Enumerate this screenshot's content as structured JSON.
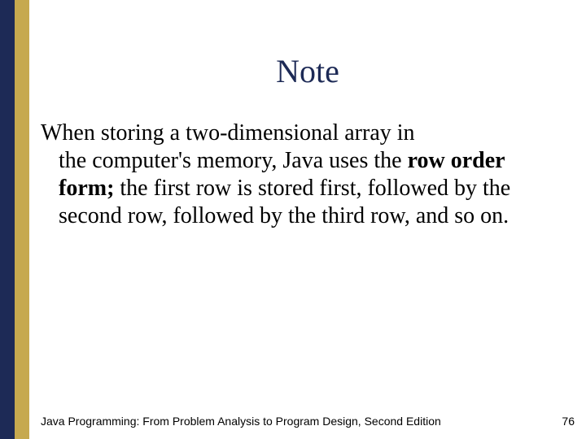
{
  "slide": {
    "title": "Note",
    "body_line1": "When storing a two-dimensional array in",
    "body_rest_pre_bold": "the computer's memory, Java uses the ",
    "body_bold": "row order form;",
    "body_rest_post_bold": " the first row is stored first, followed by the second row, followed by the third row, and so on."
  },
  "footer": {
    "book_title": "Java Programming: From Problem Analysis to Program Design, Second Edition",
    "page_number": "76"
  },
  "colors": {
    "navy": "#1d2a56",
    "gold": "#c6a94f"
  }
}
